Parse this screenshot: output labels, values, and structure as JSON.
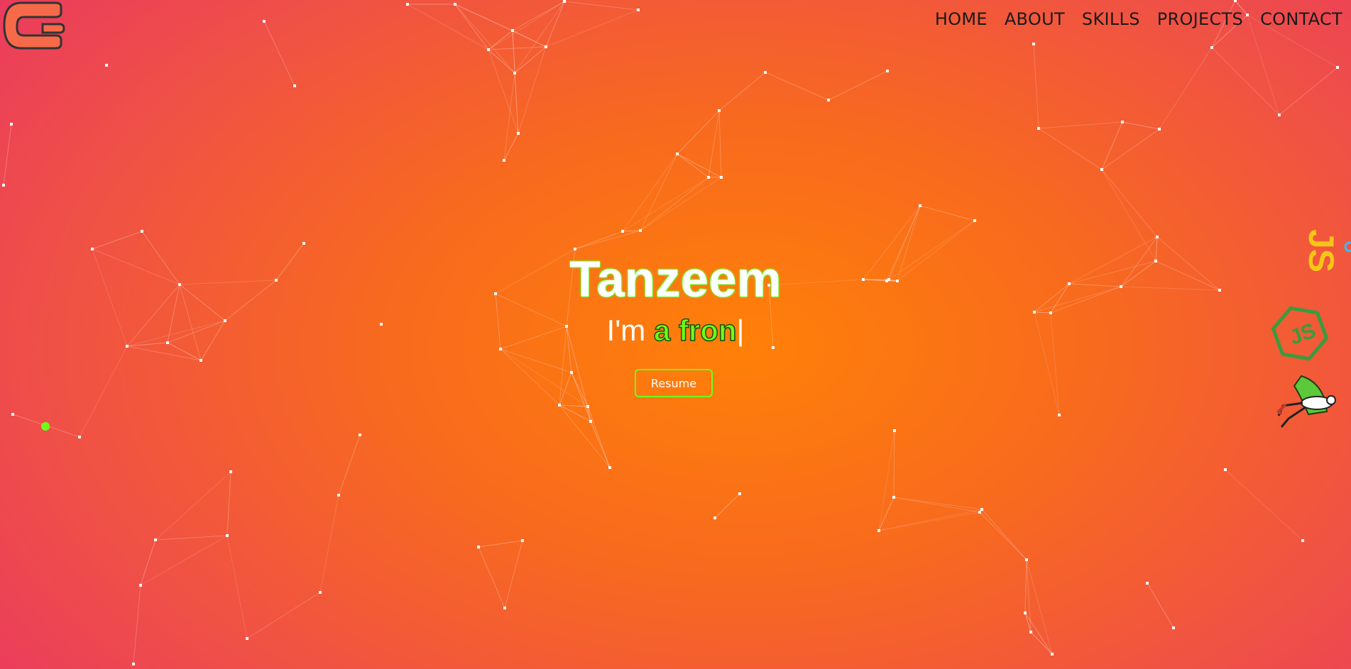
{
  "logo": {
    "icon": "logo-icon",
    "colors": [
      "#ff5a36",
      "#2b2b2b"
    ]
  },
  "nav": {
    "items": [
      "HOME",
      "ABOUT",
      "SKILLS",
      "PROJECTS",
      "CONTACT"
    ]
  },
  "hero": {
    "name": "Tanzeem",
    "prefix": "I'm ",
    "typed": "a fron",
    "caret": "|",
    "resume_label": "Resume"
  },
  "floating_icons": [
    "js-icon",
    "nodejs-icon",
    "superhero-icon"
  ],
  "colors": {
    "accent": "#6dff1a",
    "nav_text": "#1a1a1a",
    "background_center": "#ff8008",
    "background_edge": "#e93366",
    "network": "#ffd6cc"
  }
}
